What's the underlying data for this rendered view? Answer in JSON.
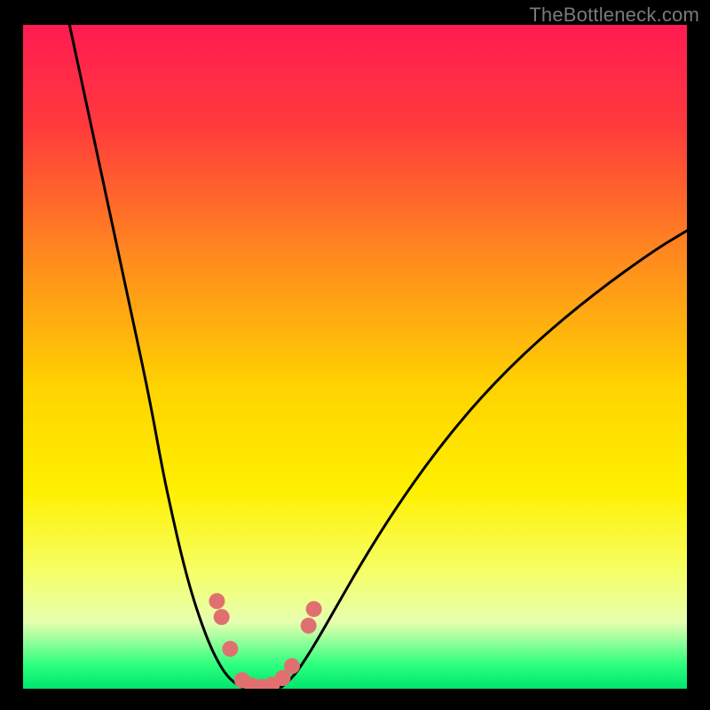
{
  "watermark": {
    "text": "TheBottleneck.com"
  },
  "chart_data": {
    "type": "line",
    "title": "",
    "xlabel": "",
    "ylabel": "",
    "xlim": [
      0,
      100
    ],
    "ylim": [
      0,
      100
    ],
    "gradient_stops": [
      {
        "offset": 0.0,
        "color": "#ff1b52"
      },
      {
        "offset": 0.15,
        "color": "#ff3a3c"
      },
      {
        "offset": 0.35,
        "color": "#ff8a1e"
      },
      {
        "offset": 0.55,
        "color": "#ffd400"
      },
      {
        "offset": 0.7,
        "color": "#fff000"
      },
      {
        "offset": 0.82,
        "color": "#f6ff63"
      },
      {
        "offset": 0.9,
        "color": "#e6ffb0"
      },
      {
        "offset": 0.965,
        "color": "#2bff7e"
      },
      {
        "offset": 1.0,
        "color": "#00e56e"
      }
    ],
    "series": [
      {
        "name": "left-curve",
        "x": [
          7.0,
          10.0,
          13.0,
          16.0,
          19.0,
          21.0,
          22.5,
          24.0,
          25.5,
          27.0,
          28.3,
          29.5,
          30.6,
          31.7,
          32.8
        ],
        "y": [
          100.0,
          86.0,
          72.0,
          58.0,
          44.0,
          33.0,
          26.0,
          19.5,
          14.0,
          9.5,
          6.2,
          3.8,
          2.1,
          1.0,
          0.3
        ]
      },
      {
        "name": "valley-floor",
        "x": [
          32.8,
          34.0,
          35.2,
          36.5,
          37.8,
          39.0
        ],
        "y": [
          0.3,
          0.0,
          0.0,
          0.0,
          0.0,
          0.3
        ]
      },
      {
        "name": "right-curve",
        "x": [
          39.0,
          40.5,
          42.0,
          44.0,
          47.0,
          51.0,
          56.0,
          62.0,
          69.0,
          77.0,
          86.0,
          95.0,
          100.0
        ],
        "y": [
          0.3,
          1.6,
          3.6,
          6.8,
          12.0,
          19.0,
          27.0,
          35.5,
          44.0,
          52.0,
          59.5,
          66.0,
          69.0
        ]
      }
    ],
    "markers": {
      "name": "highlight-dots",
      "color": "#e07070",
      "radius_px": 9,
      "points": [
        {
          "x": 29.2,
          "y": 13.2
        },
        {
          "x": 29.9,
          "y": 10.8
        },
        {
          "x": 31.2,
          "y": 6.0
        },
        {
          "x": 33.0,
          "y": 1.3
        },
        {
          "x": 34.4,
          "y": 0.5
        },
        {
          "x": 35.9,
          "y": 0.3
        },
        {
          "x": 37.5,
          "y": 0.6
        },
        {
          "x": 39.1,
          "y": 1.6
        },
        {
          "x": 40.5,
          "y": 3.4
        },
        {
          "x": 43.0,
          "y": 9.5
        },
        {
          "x": 43.8,
          "y": 12.0
        }
      ]
    }
  }
}
